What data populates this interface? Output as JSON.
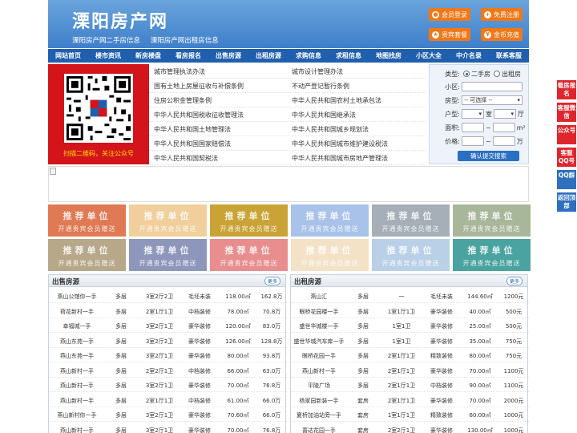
{
  "header": {
    "logo": "溧阳房产网",
    "subtitle": [
      "溧阳房产网二手房信息",
      "溧阳房产网出租房信息"
    ],
    "buttons": [
      {
        "label": "会员登录",
        "icon": "user-icon"
      },
      {
        "label": "免费注册",
        "icon": "register-icon"
      },
      {
        "label": "贵宾套餐",
        "icon": "package-icon"
      },
      {
        "label": "金币充值",
        "icon": "coin-icon"
      }
    ]
  },
  "nav": [
    "网站首页",
    "楼市资讯",
    "新房楼盘",
    "看房报名",
    "出售房源",
    "出租房源",
    "求购信息",
    "求租信息",
    "地图找房",
    "小区大全",
    "中介名录",
    "联系客服"
  ],
  "qr": {
    "caption": "扫描二维码，关注公众号"
  },
  "links": [
    [
      "城市管理执法办法",
      "城市设计管理办法"
    ],
    [
      "国有土地上房屋征收与补偿条例",
      "不动产登记暂行条例"
    ],
    [
      "住房公积金管理条例",
      "中华人民共和国农村土地承包法"
    ],
    [
      "中华人民共和国税收征收管理法",
      "中华人民共和国继承法"
    ],
    [
      "中华人民共和国土地管理法",
      "中华人民共和国城乡规划法"
    ],
    [
      "中华人民共和国国家赔偿法",
      "中华人民共和国城市维护建设税法"
    ],
    [
      "中华人民共和国契税法",
      "中华人民共和国城市房地产管理法"
    ]
  ],
  "search": {
    "type_label": "类型:",
    "type_options": [
      "二手房",
      "出租房"
    ],
    "community_label": "小区:",
    "house_label": "房型:",
    "house_select": "-- 可选择 --",
    "layout_label": "户型:",
    "room_unit": "室",
    "hall_unit": "厅",
    "area_label": "面积:",
    "area_unit": "m²",
    "price_label": "价格:",
    "price_unit": "万",
    "range_sep": "~",
    "submit": "确认提交搜索"
  },
  "tiles": {
    "title": "推荐单位",
    "sub": "开通贵宾会员赠送",
    "colors": [
      "#e07a55",
      "#f0cf9c",
      "#c9a335",
      "#a9c2ea",
      "#a6aeb8",
      "#a8b79a",
      "#b7a88a",
      "#8e97bb",
      "#e88e8e",
      "#f3e2c6",
      "#b9d0e6",
      "#4aa3a0"
    ]
  },
  "sale": {
    "title": "出售房源",
    "more": "更多",
    "rows": [
      [
        "燕山公馆你一手",
        "多层",
        "3室2厅2卫",
        "毛坯未装",
        "118.00㎡",
        "162.8万"
      ],
      [
        "荷花新村一手",
        "多层",
        "2室1厅1卫",
        "中档装修",
        "78.00㎡",
        "70.8万"
      ],
      [
        "幸福城一手",
        "多层",
        "3室2厅1卫",
        "豪华装修",
        "120.00㎡",
        "83.0万"
      ],
      [
        "燕山东苑一手",
        "多层",
        "3室2厅2卫",
        "豪华装修",
        "126.00㎡",
        "128.8万"
      ],
      [
        "燕山东苑一手",
        "多层",
        "3室2厅1卫",
        "豪华装修",
        "80.00㎡",
        "93.8万"
      ],
      [
        "燕山新村一手",
        "多层",
        "2室2厅1卫",
        "中档装修",
        "66.00㎡",
        "63.0万"
      ],
      [
        "燕山新村一手",
        "多层",
        "3室2厅1卫",
        "豪华装修",
        "70.00㎡",
        "76.8万"
      ],
      [
        "燕山新村一手",
        "多层",
        "2室1厅1卫",
        "中档装修",
        "61.00㎡",
        "66.0万"
      ],
      [
        "燕山新村你一手",
        "多层",
        "3室2厅1卫",
        "豪华装修",
        "70.60㎡",
        "66.0万"
      ],
      [
        "燕山新村一手",
        "多层",
        "3室2厅1卫",
        "豪华装修",
        "70.00㎡",
        "76.8万"
      ]
    ]
  },
  "rent": {
    "title": "出租房源",
    "more": "更多",
    "rows": [
      [
        "燕山汇",
        "多层",
        "一",
        "毛坯未装",
        "144.60㎡",
        "1200元"
      ],
      [
        "眼桥花园楼一手",
        "多层",
        "1室1厅1卫",
        "豪华装修",
        "40.00㎡",
        "500元"
      ],
      [
        "盛世华城楼一手",
        "多层",
        "1室1卫",
        "豪华装修",
        "25.00㎡",
        "500元"
      ],
      [
        "盛世华城汽车库一手",
        "多层",
        "1室1卫",
        "豪华装修",
        "35.00㎡",
        "750元"
      ],
      [
        "眼桥花园一手",
        "多层",
        "2室1厅1卫",
        "精致装修",
        "80.00㎡",
        "750元"
      ],
      [
        "燕山新村一手",
        "多层",
        "2室1厅1卫",
        "豪华装修",
        "70.00㎡",
        "1100元"
      ],
      [
        "平陵广场",
        "多层",
        "2室1厅1卫",
        "中档装修",
        "90.00㎡",
        "1100元"
      ],
      [
        "杨家园新装一手",
        "套房",
        "2室1厅1卫",
        "豪华装修",
        "70.00㎡",
        "2000元"
      ],
      [
        "夏桥加油站旁一手",
        "套房",
        "1室1厅1卫",
        "精致装修",
        "60.00㎡",
        "1000元"
      ],
      [
        "蔷达花园一手",
        "套房",
        "2室2厅1卫",
        "豪华装修",
        "130.00㎡",
        "1000元"
      ]
    ]
  },
  "float": [
    {
      "label": "看房报名",
      "color": "red"
    },
    {
      "label": "客服微信",
      "color": "red"
    },
    {
      "label": "公众号",
      "color": "red"
    },
    {
      "label": "客服QQ号",
      "color": "red"
    },
    {
      "label": "QQ群",
      "color": "blue"
    },
    {
      "label": "返回顶部",
      "color": "blue"
    }
  ]
}
